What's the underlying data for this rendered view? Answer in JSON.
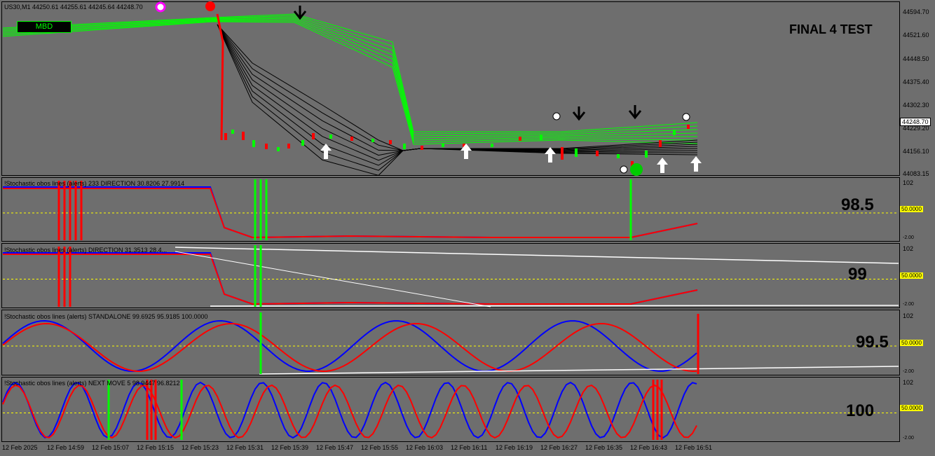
{
  "symbol_header": "US30,M1  44250.61 44255.61 44245.64 44248.70",
  "chart_title": "FINAL 4 TEST",
  "mbd_label": "MBD",
  "price_axis": [
    "44594.70",
    "44521.60",
    "44448.50",
    "44375.40",
    "44302.30",
    "44229.20",
    "44156.10",
    "44083.15"
  ],
  "current_price": "44248.70",
  "indicators": [
    {
      "title": "!Stochastic obos lines (alerts) 233 DIRECTION 30.8206 27.9914",
      "value": "98.5",
      "top": "102",
      "level": "50.0000",
      "bottom": "-2.00"
    },
    {
      "title": "!Stochastic obos lines (alerts) DIRECTION 31.3513 28.4...",
      "value": "99",
      "top": "102",
      "level": "50.0000",
      "bottom": "-2.00"
    },
    {
      "title": "!Stochastic obos lines (alerts) STANDALONE 99.6925 95.9185 100.0000",
      "value": "99.5",
      "top": "102",
      "level": "50.0000",
      "bottom": "-2.00"
    },
    {
      "title": "!Stochastic obos lines (alerts) NEXT MOVE 5 98.9447 96.8212",
      "value": "100",
      "top": "102",
      "level": "50.0000",
      "bottom": "-2.00"
    }
  ],
  "time_axis": [
    "12 Feb 2025",
    "12 Feb 14:59",
    "12 Feb 15:07",
    "12 Feb 15:15",
    "12 Feb 15:23",
    "12 Feb 15:31",
    "12 Feb 15:39",
    "12 Feb 15:47",
    "12 Feb 15:55",
    "12 Feb 16:03",
    "12 Feb 16:11",
    "12 Feb 16:19",
    "12 Feb 16:27",
    "12 Feb 16:35",
    "12 Feb 16:43",
    "12 Feb 16:51"
  ],
  "colors": {
    "background": "#6e6e6e",
    "bull": "#00ff00",
    "bear": "#ff0000",
    "stoch_main": "#0000ff",
    "stoch_signal": "#ff0000",
    "level": "#ffff00"
  }
}
